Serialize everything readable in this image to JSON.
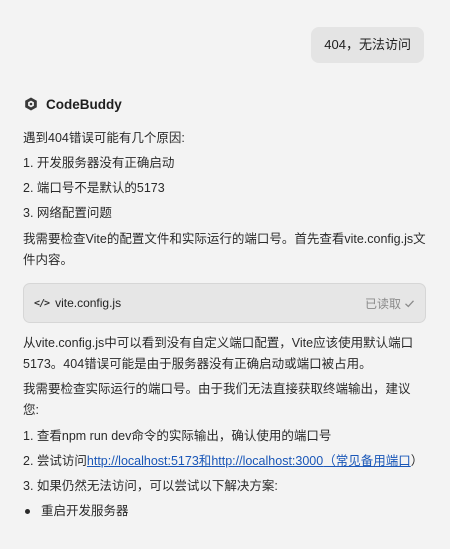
{
  "user_message": "404，无法访问",
  "assistant": {
    "name": "CodeBuddy",
    "logo": "codebuddy-hex-logo"
  },
  "response": {
    "intro": "遇到404错误可能有几个原因:",
    "reasons": [
      "1. 开发服务器没有正确启动",
      "2. 端口号不是默认的5173",
      "3. 网络配置问题"
    ],
    "check_text": "我需要检查Vite的配置文件和实际运行的端口号。首先查看vite.config.js文件内容。",
    "file_card": {
      "icon": "code-icon",
      "file_name": "vite.config.js",
      "status": "已读取",
      "status_icon": "check-icon"
    },
    "analysis": "从vite.config.js中可以看到没有自定义端口配置，Vite应该使用默认端口5173。404错误可能是由于服务器没有正确启动或端口被占用。",
    "next_check": "我需要检查实际运行的端口号。由于我们无法直接获取终端输出，建议您:",
    "suggestions": {
      "s1": "1. 查看npm run dev命令的实际输出，确认使用的端口号",
      "s2_prefix": "2. 尝试访问",
      "s2_link1": "http://localhost:5173",
      "s2_and": "和",
      "s2_link2": "http://localhost:3000",
      "s2_note": "（常见备用端口",
      "s2_close": "）",
      "s3": "3. 如果仍然无法访问，可以尝试以下解决方案:"
    },
    "solutions": [
      "重启开发服务器"
    ]
  },
  "colors": {
    "link": "#1a57b8",
    "background": "#f3f3f3",
    "bubble": "#e4e4e4"
  }
}
